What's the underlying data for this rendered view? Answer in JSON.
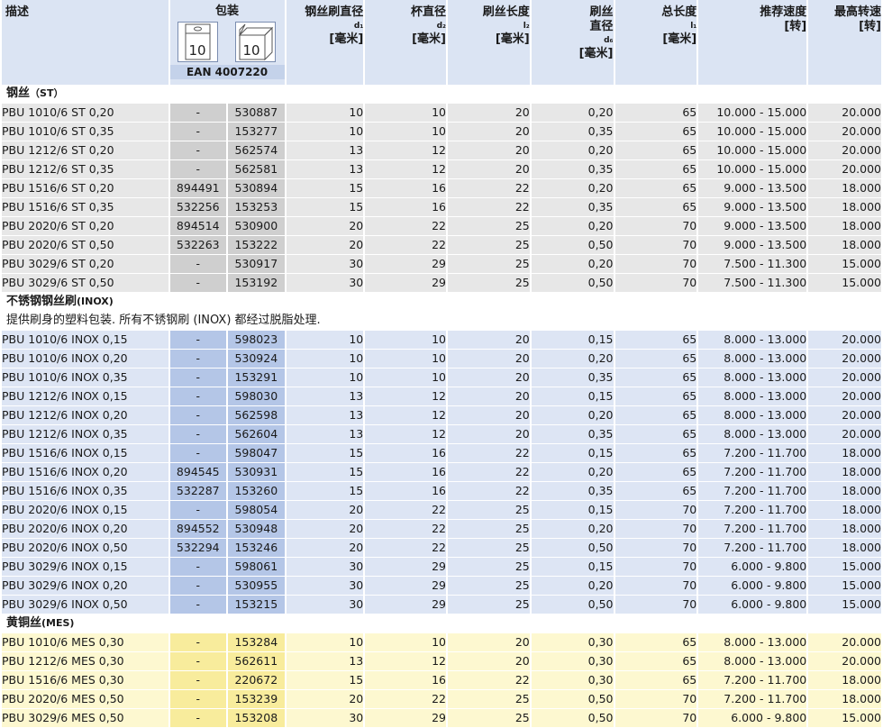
{
  "header": {
    "desc": "描述",
    "pack": "包装",
    "pack_icon_1": "10",
    "pack_icon_2": "10",
    "ean": "EAN 4007220",
    "d1_title": "钢丝刷直径",
    "d1_sub": "d₁",
    "d1_unit": "[毫米]",
    "d2_title": "杯直径",
    "d2_sub": "d₂",
    "d2_unit": "[毫米]",
    "l2_title": "刷丝长度",
    "l2_sub": "l₂",
    "l2_unit": "[毫米]",
    "d6_title1": "刷丝",
    "d6_title2": "直径",
    "d6_sub": "d₆",
    "d6_unit": "[毫米]",
    "l1_title": "总长度",
    "l1_sub": "l₁",
    "l1_unit": "[毫米]",
    "speed_title": "推荐速度",
    "speed_unit": "[转]",
    "max_title": "最高转速",
    "max_unit": "[转]"
  },
  "sections": [
    {
      "title": "钢丝",
      "code": "（ST）",
      "note": "",
      "style": "st",
      "rows": [
        [
          "PBU 1010/6 ST 0,20",
          "-",
          "530887",
          "10",
          "10",
          "20",
          "0,20",
          "65",
          "10.000 - 15.000",
          "20.000"
        ],
        [
          "PBU 1010/6 ST 0,35",
          "-",
          "153277",
          "10",
          "10",
          "20",
          "0,35",
          "65",
          "10.000 - 15.000",
          "20.000"
        ],
        [
          "PBU 1212/6 ST 0,20",
          "-",
          "562574",
          "13",
          "12",
          "20",
          "0,20",
          "65",
          "10.000 - 15.000",
          "20.000"
        ],
        [
          "PBU 1212/6 ST 0,35",
          "-",
          "562581",
          "13",
          "12",
          "20",
          "0,35",
          "65",
          "10.000 - 15.000",
          "20.000"
        ],
        [
          "PBU 1516/6 ST 0,20",
          "894491",
          "530894",
          "15",
          "16",
          "22",
          "0,20",
          "65",
          "9.000 - 13.500",
          "18.000"
        ],
        [
          "PBU 1516/6 ST 0,35",
          "532256",
          "153253",
          "15",
          "16",
          "22",
          "0,35",
          "65",
          "9.000 - 13.500",
          "18.000"
        ],
        [
          "PBU 2020/6 ST 0,20",
          "894514",
          "530900",
          "20",
          "22",
          "25",
          "0,20",
          "70",
          "9.000 - 13.500",
          "18.000"
        ],
        [
          "PBU 2020/6 ST 0,50",
          "532263",
          "153222",
          "20",
          "22",
          "25",
          "0,50",
          "70",
          "9.000 - 13.500",
          "18.000"
        ],
        [
          "PBU 3029/6 ST 0,20",
          "-",
          "530917",
          "30",
          "29",
          "25",
          "0,20",
          "70",
          "7.500 - 11.300",
          "15.000"
        ],
        [
          "PBU 3029/6 ST 0,50",
          "-",
          "153192",
          "30",
          "29",
          "25",
          "0,50",
          "70",
          "7.500 - 11.300",
          "15.000"
        ]
      ]
    },
    {
      "title": "不锈钢钢丝刷",
      "code": "(INOX)",
      "note": "提供刷身的塑料包装. 所有不锈钢刷 (INOX) 都经过脱脂处理.",
      "style": "inox",
      "rows": [
        [
          "PBU 1010/6 INOX 0,15",
          "-",
          "598023",
          "10",
          "10",
          "20",
          "0,15",
          "65",
          "8.000 - 13.000",
          "20.000"
        ],
        [
          "PBU 1010/6 INOX 0,20",
          "-",
          "530924",
          "10",
          "10",
          "20",
          "0,20",
          "65",
          "8.000 - 13.000",
          "20.000"
        ],
        [
          "PBU 1010/6 INOX 0,35",
          "-",
          "153291",
          "10",
          "10",
          "20",
          "0,35",
          "65",
          "8.000 - 13.000",
          "20.000"
        ],
        [
          "PBU 1212/6 INOX 0,15",
          "-",
          "598030",
          "13",
          "12",
          "20",
          "0,15",
          "65",
          "8.000 - 13.000",
          "20.000"
        ],
        [
          "PBU 1212/6 INOX 0,20",
          "-",
          "562598",
          "13",
          "12",
          "20",
          "0,20",
          "65",
          "8.000 - 13.000",
          "20.000"
        ],
        [
          "PBU 1212/6 INOX 0,35",
          "-",
          "562604",
          "13",
          "12",
          "20",
          "0,35",
          "65",
          "8.000 - 13.000",
          "20.000"
        ],
        [
          "PBU 1516/6 INOX 0,15",
          "-",
          "598047",
          "15",
          "16",
          "22",
          "0,15",
          "65",
          "7.200 - 11.700",
          "18.000"
        ],
        [
          "PBU 1516/6 INOX 0,20",
          "894545",
          "530931",
          "15",
          "16",
          "22",
          "0,20",
          "65",
          "7.200 - 11.700",
          "18.000"
        ],
        [
          "PBU 1516/6 INOX 0,35",
          "532287",
          "153260",
          "15",
          "16",
          "22",
          "0,35",
          "65",
          "7.200 - 11.700",
          "18.000"
        ],
        [
          "PBU 2020/6 INOX 0,15",
          "-",
          "598054",
          "20",
          "22",
          "25",
          "0,15",
          "70",
          "7.200 - 11.700",
          "18.000"
        ],
        [
          "PBU 2020/6 INOX 0,20",
          "894552",
          "530948",
          "20",
          "22",
          "25",
          "0,20",
          "70",
          "7.200 - 11.700",
          "18.000"
        ],
        [
          "PBU 2020/6 INOX 0,50",
          "532294",
          "153246",
          "20",
          "22",
          "25",
          "0,50",
          "70",
          "7.200 - 11.700",
          "18.000"
        ],
        [
          "PBU 3029/6 INOX 0,15",
          "-",
          "598061",
          "30",
          "29",
          "25",
          "0,15",
          "70",
          "6.000 - 9.800",
          "15.000"
        ],
        [
          "PBU 3029/6 INOX 0,20",
          "-",
          "530955",
          "30",
          "29",
          "25",
          "0,20",
          "70",
          "6.000 - 9.800",
          "15.000"
        ],
        [
          "PBU 3029/6 INOX 0,50",
          "-",
          "153215",
          "30",
          "29",
          "25",
          "0,50",
          "70",
          "6.000 - 9.800",
          "15.000"
        ]
      ]
    },
    {
      "title": "黄铜丝",
      "code": "(MES)",
      "note": "",
      "style": "mes",
      "rows": [
        [
          "PBU 1010/6 MES 0,30",
          "-",
          "153284",
          "10",
          "10",
          "20",
          "0,30",
          "65",
          "8.000 - 13.000",
          "20.000"
        ],
        [
          "PBU 1212/6 MES 0,30",
          "-",
          "562611",
          "13",
          "12",
          "20",
          "0,30",
          "65",
          "8.000 - 13.000",
          "20.000"
        ],
        [
          "PBU 1516/6 MES 0,30",
          "-",
          "220672",
          "15",
          "16",
          "22",
          "0,30",
          "65",
          "7.200 - 11.700",
          "18.000"
        ],
        [
          "PBU 2020/6 MES 0,50",
          "-",
          "153239",
          "20",
          "22",
          "25",
          "0,50",
          "70",
          "7.200 - 11.700",
          "18.000"
        ],
        [
          "PBU 3029/6 MES 0,50",
          "-",
          "153208",
          "30",
          "29",
          "25",
          "0,50",
          "70",
          "6.000 - 9.800",
          "15.000"
        ]
      ]
    }
  ]
}
